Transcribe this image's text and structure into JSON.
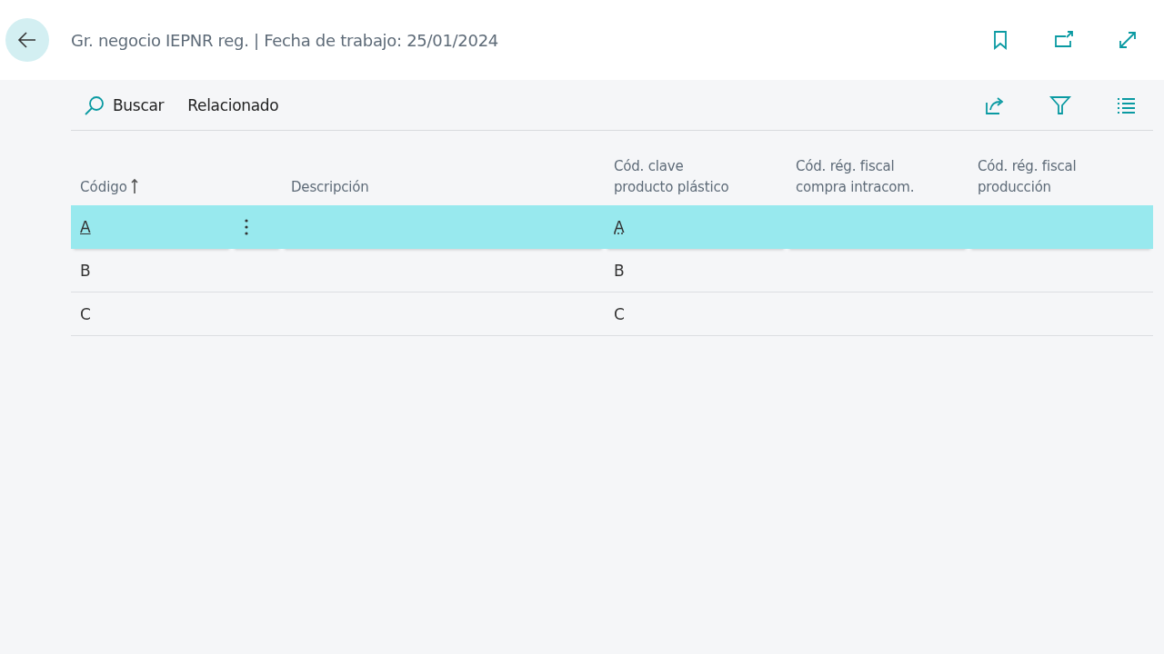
{
  "header": {
    "title": "Gr. negocio IEPNR reg. | Fecha de trabajo: 25/01/2024"
  },
  "toolbar": {
    "actions": [
      "Buscar",
      "Relacionado"
    ]
  },
  "table": {
    "columns": [
      {
        "label": "Código",
        "sorted_ascending": true
      },
      {
        "label": "Descripción"
      },
      {
        "label": "Cód. clave producto plástico"
      },
      {
        "label": "Cód. rég. fiscal compra intracom."
      },
      {
        "label": "Cód. rég. fiscal producción"
      }
    ],
    "rows": [
      {
        "selected": true,
        "cells": [
          "A",
          "",
          "A",
          "",
          ""
        ]
      },
      {
        "selected": false,
        "cells": [
          "B",
          "",
          "B",
          "",
          ""
        ]
      },
      {
        "selected": false,
        "cells": [
          "C",
          "",
          "C",
          "",
          ""
        ]
      }
    ]
  }
}
